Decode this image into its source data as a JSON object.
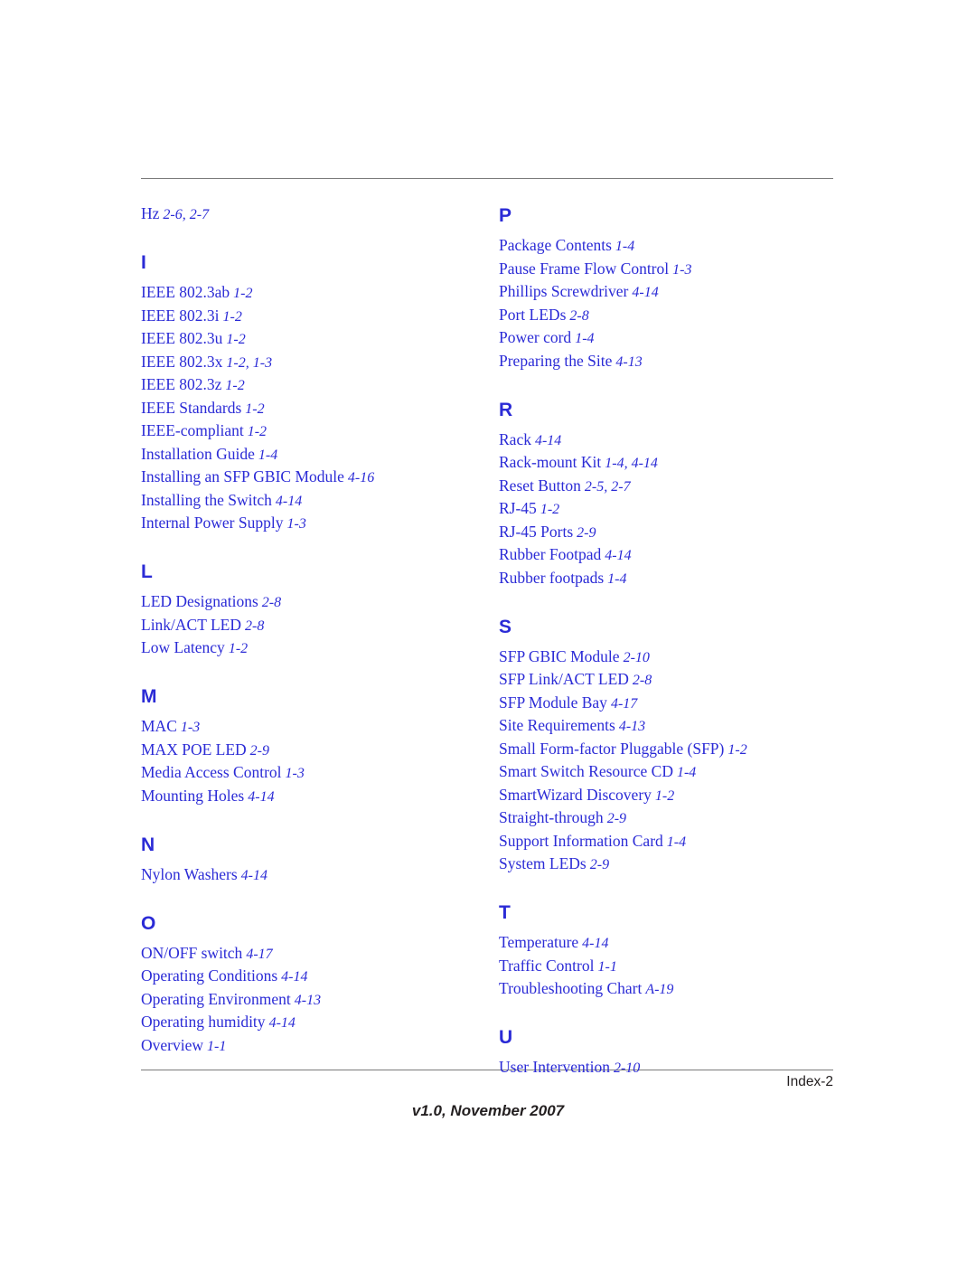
{
  "page": {
    "footer_index": "Index-2",
    "footer_version": "v1.0, November 2007"
  },
  "columns": [
    {
      "name": "left",
      "blocks": [
        {
          "heading": null,
          "entries": [
            {
              "text": "Hz",
              "page": "2-6, 2-7"
            }
          ]
        },
        {
          "heading": "I",
          "entries": [
            {
              "text": "IEEE 802.3ab",
              "page": "1-2"
            },
            {
              "text": "IEEE 802.3i",
              "page": "1-2"
            },
            {
              "text": "IEEE 802.3u",
              "page": "1-2"
            },
            {
              "text": "IEEE 802.3x",
              "page": "1-2, 1-3"
            },
            {
              "text": "IEEE 802.3z",
              "page": "1-2"
            },
            {
              "text": "IEEE Standards",
              "page": "1-2"
            },
            {
              "text": "IEEE-compliant",
              "page": "1-2"
            },
            {
              "text": "Installation Guide",
              "page": "1-4"
            },
            {
              "text": "Installing an SFP GBIC Module",
              "page": "4-16"
            },
            {
              "text": "Installing the Switch",
              "page": "4-14"
            },
            {
              "text": "Internal Power Supply",
              "page": "1-3"
            }
          ]
        },
        {
          "heading": "L",
          "entries": [
            {
              "text": "LED Designations",
              "page": "2-8"
            },
            {
              "text": "Link/ACT LED",
              "page": "2-8"
            },
            {
              "text": "Low Latency",
              "page": "1-2"
            }
          ]
        },
        {
          "heading": "M",
          "entries": [
            {
              "text": "MAC",
              "page": "1-3"
            },
            {
              "text": "MAX POE LED",
              "page": "2-9"
            },
            {
              "text": "Media Access Control",
              "page": "1-3"
            },
            {
              "text": "Mounting Holes",
              "page": "4-14"
            }
          ]
        },
        {
          "heading": "N",
          "entries": [
            {
              "text": "Nylon Washers",
              "page": "4-14"
            }
          ]
        },
        {
          "heading": "O",
          "entries": [
            {
              "text": "ON/OFF switch",
              "page": "4-17"
            },
            {
              "text": "Operating Conditions",
              "page": "4-14"
            },
            {
              "text": "Operating Environment",
              "page": "4-13"
            },
            {
              "text": "Operating humidity",
              "page": "4-14"
            },
            {
              "text": "Overview",
              "page": "1-1"
            }
          ]
        }
      ]
    },
    {
      "name": "right",
      "blocks": [
        {
          "heading": "P",
          "entries": [
            {
              "text": "Package Contents",
              "page": "1-4"
            },
            {
              "text": "Pause Frame Flow Control",
              "page": "1-3"
            },
            {
              "text": "Phillips Screwdriver",
              "page": "4-14"
            },
            {
              "text": "Port LEDs",
              "page": "2-8"
            },
            {
              "text": "Power cord",
              "page": "1-4"
            },
            {
              "text": "Preparing the Site",
              "page": "4-13"
            }
          ]
        },
        {
          "heading": "R",
          "entries": [
            {
              "text": "Rack",
              "page": "4-14"
            },
            {
              "text": "Rack-mount Kit",
              "page": "1-4, 4-14"
            },
            {
              "text": "Reset Button",
              "page": "2-5, 2-7"
            },
            {
              "text": "RJ-45",
              "page": "1-2"
            },
            {
              "text": "RJ-45 Ports",
              "page": "2-9"
            },
            {
              "text": "Rubber Footpad",
              "page": "4-14"
            },
            {
              "text": "Rubber footpads",
              "page": "1-4"
            }
          ]
        },
        {
          "heading": "S",
          "entries": [
            {
              "text": "SFP GBIC Module",
              "page": "2-10"
            },
            {
              "text": "SFP Link/ACT LED",
              "page": "2-8"
            },
            {
              "text": "SFP Module Bay",
              "page": "4-17"
            },
            {
              "text": "Site Requirements",
              "page": "4-13"
            },
            {
              "text": "Small Form-factor Pluggable (SFP)",
              "page": "1-2"
            },
            {
              "text": "Smart Switch Resource CD",
              "page": "1-4"
            },
            {
              "text": "SmartWizard Discovery",
              "page": "1-2"
            },
            {
              "text": "Straight-through",
              "page": "2-9"
            },
            {
              "text": "Support Information Card",
              "page": "1-4"
            },
            {
              "text": "System LEDs",
              "page": "2-9"
            }
          ]
        },
        {
          "heading": "T",
          "entries": [
            {
              "text": "Temperature",
              "page": "4-14"
            },
            {
              "text": "Traffic Control",
              "page": "1-1"
            },
            {
              "text": "Troubleshooting Chart",
              "page": "A-19"
            }
          ]
        },
        {
          "heading": "U",
          "entries": [
            {
              "text": "User Intervention",
              "page": "2-10"
            }
          ]
        }
      ]
    }
  ],
  "style": {
    "link_color": "#2b2bd6",
    "text_color": "#231f20",
    "rule_color": "#7a7a7a"
  }
}
